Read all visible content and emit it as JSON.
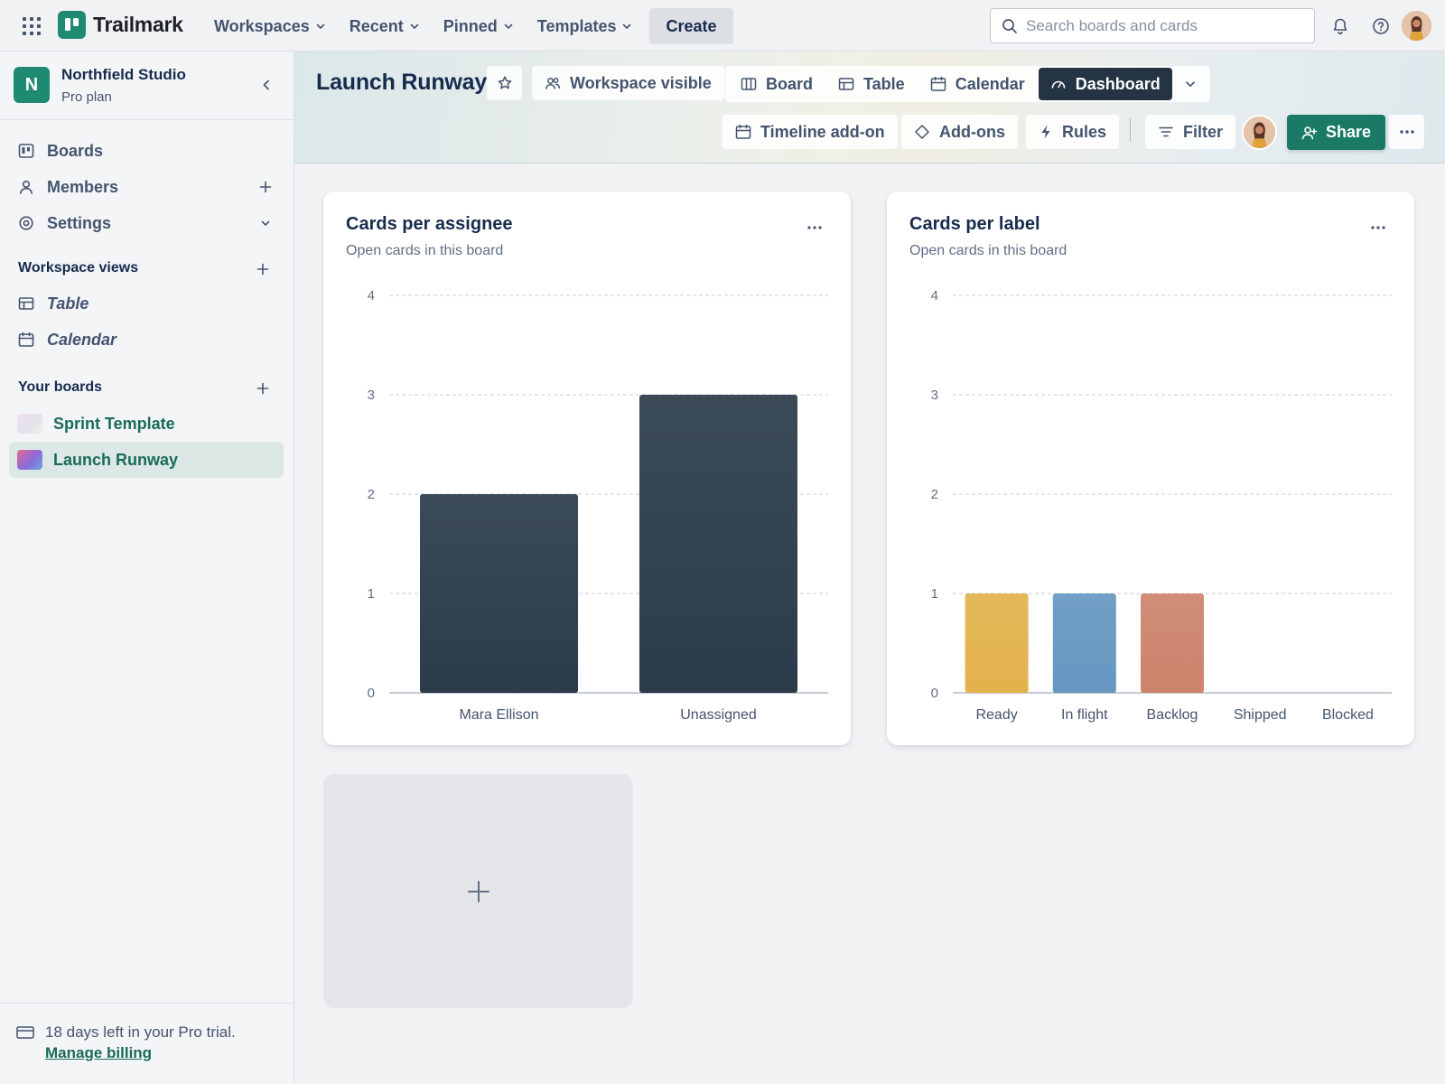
{
  "topbar": {
    "brand": "Trailmark",
    "nav": [
      {
        "label": "Workspaces"
      },
      {
        "label": "Recent"
      },
      {
        "label": "Pinned"
      },
      {
        "label": "Templates"
      }
    ],
    "create_label": "Create",
    "search_placeholder": "Search boards and cards",
    "icons": [
      "apps-grid-icon",
      "bell-icon",
      "help-icon",
      "user-avatar"
    ]
  },
  "sidebar": {
    "workspace_initial": "N",
    "workspace_name": "Northfield Studio",
    "workspace_plan": "Pro plan",
    "items": [
      {
        "label": "Boards",
        "icon": "boards-icon"
      },
      {
        "label": "Members",
        "icon": "person-icon"
      },
      {
        "label": "Settings",
        "icon": "gear-icon"
      }
    ],
    "views_heading": "Workspace views",
    "views": [
      {
        "label": "Table",
        "icon": "table-icon"
      },
      {
        "label": "Calendar",
        "icon": "calendar-icon"
      }
    ],
    "boards_heading": "Your boards",
    "boards": [
      {
        "label": "Sprint Template",
        "active": false
      },
      {
        "label": "Launch Runway",
        "active": true
      }
    ],
    "trial_text": "18 days left in your Pro trial.",
    "trial_link": "Manage billing"
  },
  "board": {
    "title": "Launch Runway",
    "visibility_label": "Workspace visible",
    "views": [
      {
        "label": "Board",
        "active": false
      },
      {
        "label": "Table",
        "active": false
      },
      {
        "label": "Calendar",
        "active": false
      },
      {
        "label": "Dashboard",
        "active": true
      }
    ],
    "actions": {
      "timeline": "Timeline add-on",
      "addons": "Add-ons",
      "rules": "Rules",
      "filter": "Filter",
      "share": "Share"
    }
  },
  "colors": {
    "accent": "#1f8a72",
    "share": "#1a7a66",
    "dark_bar": "#2b3b4a",
    "ready": "#e2b24b",
    "in_flight": "#6597c0",
    "backlog": "#cc836b"
  },
  "chart_data": [
    {
      "type": "bar",
      "title": "Cards per assignee",
      "subtitle": "Open cards in this board",
      "categories": [
        "Mara Ellison",
        "Unassigned"
      ],
      "values": [
        2,
        3
      ],
      "colors": [
        "#2b3b4a",
        "#2b3b4a"
      ],
      "yticks": [
        "0",
        "1",
        "2",
        "3",
        "4"
      ],
      "ylim": [
        0,
        4
      ],
      "grid": true
    },
    {
      "type": "bar",
      "title": "Cards per label",
      "subtitle": "Open cards in this board",
      "categories": [
        "Ready",
        "In flight",
        "Backlog",
        "Shipped",
        "Blocked"
      ],
      "values": [
        1,
        1,
        1,
        0,
        0
      ],
      "colors": [
        "#e2b24b",
        "#6597c0",
        "#cc836b",
        "#b0b8c4",
        "#d4665a"
      ],
      "yticks": [
        "0",
        "1",
        "2",
        "3",
        "4"
      ],
      "ylim": [
        0,
        4
      ],
      "grid": true
    }
  ]
}
